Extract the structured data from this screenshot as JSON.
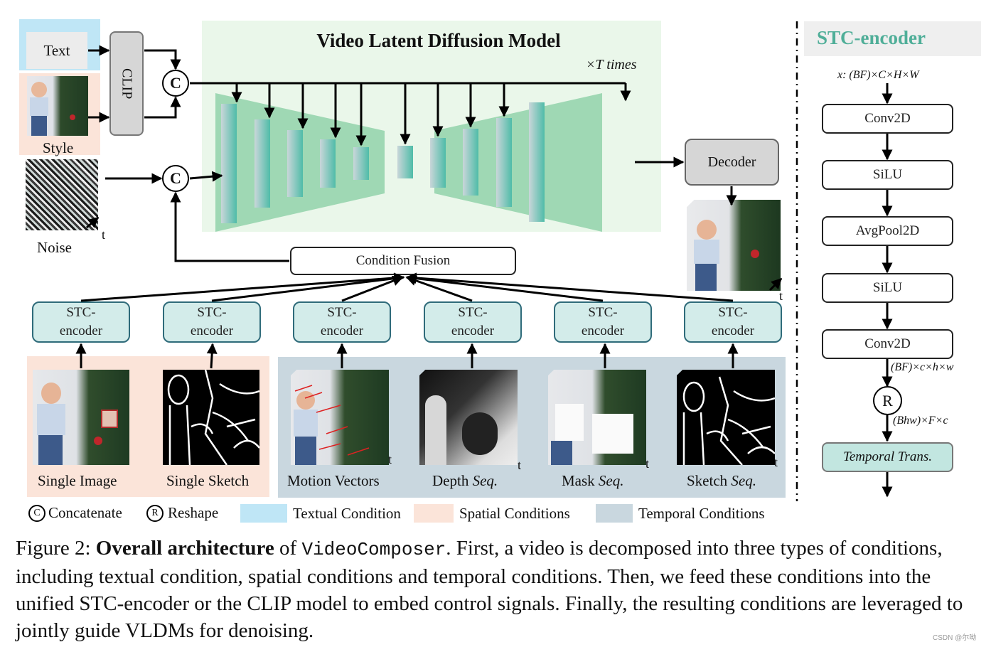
{
  "inputs": {
    "text_label": "Text",
    "style_label": "Style",
    "noise_label": "Noise",
    "time_axis_label": "t"
  },
  "clip": {
    "label": "CLIP"
  },
  "concat_symbol": "C",
  "reshape_symbol": "R",
  "vldm": {
    "title": "Video Latent Diffusion Model",
    "repeat_label": "×T times"
  },
  "decoder": {
    "label": "Decoder"
  },
  "condition_fusion": {
    "label": "Condition Fusion"
  },
  "stc_encoders": [
    {
      "line1": "STC-",
      "line2": "encoder"
    },
    {
      "line1": "STC-",
      "line2": "encoder"
    },
    {
      "line1": "STC-",
      "line2": "encoder"
    },
    {
      "line1": "STC-",
      "line2": "encoder"
    },
    {
      "line1": "STC-",
      "line2": "encoder"
    },
    {
      "line1": "STC-",
      "line2": "encoder"
    }
  ],
  "conditions": [
    {
      "label": "Single Image",
      "italic": "",
      "group": "spatial"
    },
    {
      "label": "Single Sketch",
      "italic": "",
      "group": "spatial"
    },
    {
      "label": "Motion Vectors",
      "italic": "",
      "group": "temporal"
    },
    {
      "label": "Depth ",
      "italic": "Seq.",
      "group": "temporal"
    },
    {
      "label": "Mask ",
      "italic": "Seq.",
      "group": "temporal"
    },
    {
      "label": "Sketch ",
      "italic": "Seq.",
      "group": "temporal"
    }
  ],
  "legend": {
    "concatenate": "Concatenate",
    "reshape": "Reshape",
    "textual": "Textual Condition",
    "spatial": "Spatial Conditions",
    "temporal": "Temporal Conditions"
  },
  "stc_detail": {
    "title": "STC-encoder",
    "input_shape": "x: (BF)×C×H×W",
    "layers": [
      "Conv2D",
      "SiLU",
      "AvgPool2D",
      "SiLU",
      "Conv2D"
    ],
    "shape_after_conv": "(BF)×c×h×w",
    "shape_after_reshape": "(Bhw)×F×c",
    "temporal_block": "Temporal Trans."
  },
  "caption": {
    "prefix": "Figure 2: ",
    "bold": "Overall architecture",
    "of": " of ",
    "code": "VideoComposer",
    "rest": ". First, a video is decomposed into three types of conditions, including textual condition, spatial conditions and temporal conditions. Then, we feed these conditions into the unified STC-encoder or the CLIP model to embed control signals. Finally, the resulting conditions are leveraged to jointly guide VLDMs for denoising."
  },
  "watermark": "CSDN @尔呦",
  "colors": {
    "textual": "#bfe6f6",
    "spatial": "#fbe4d9",
    "temporal": "#c9d7df",
    "vldm_bg": "#eaf7ea",
    "vldm_unet": "#9fd8b4",
    "stc_fill": "#d3ecea",
    "stc_border": "#2f6b7a",
    "stc_title": "#4fae98",
    "temporal_trans": "#c2e6e0"
  }
}
